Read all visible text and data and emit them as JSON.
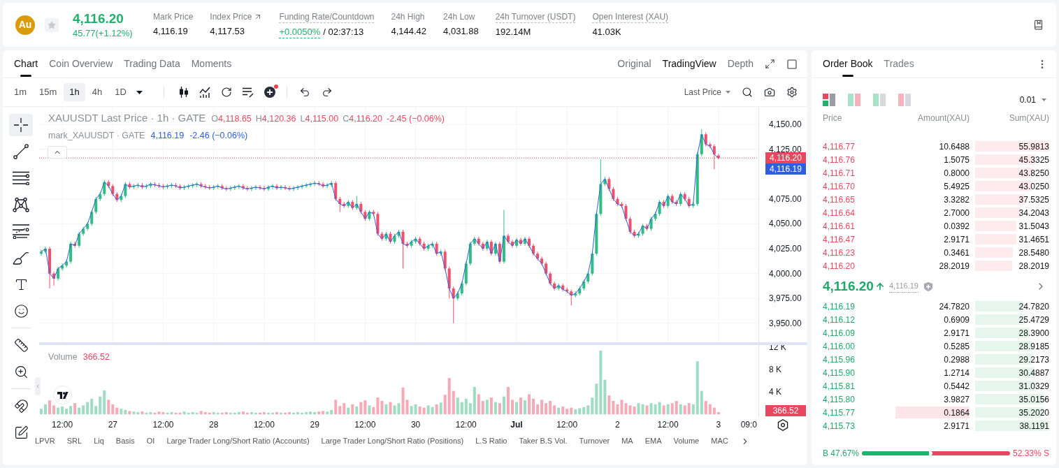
{
  "header": {
    "logo": "Au",
    "price": "4,116.20",
    "change": "45.77(+1.12%)",
    "stats": [
      {
        "label": "Mark Price",
        "value": "4,116.19",
        "kind": "plain",
        "underlined": false
      },
      {
        "label": "Index Price",
        "value": "4,117.53",
        "kind": "link",
        "underlined": false
      },
      {
        "label": "Funding Rate/Countdown",
        "value": "+0.0050%",
        "extra": "/ 02:37:13",
        "kind": "funding",
        "underlined": true
      },
      {
        "label": "24h High",
        "value": "4,144.42",
        "kind": "plain",
        "underlined": false
      },
      {
        "label": "24h Low",
        "value": "4,031.88",
        "kind": "plain",
        "underlined": false
      },
      {
        "label": "24h Turnover (USDT)",
        "value": "192.14M",
        "kind": "plain",
        "underlined": true
      },
      {
        "label": "Open Interest (XAU)",
        "value": "41.03K",
        "kind": "plain",
        "underlined": true
      }
    ]
  },
  "chart_panel": {
    "tabs": [
      {
        "label": "Chart",
        "selected": true
      },
      {
        "label": "Coin Overview",
        "selected": false
      },
      {
        "label": "Trading Data",
        "selected": false
      },
      {
        "label": "Moments",
        "selected": false
      }
    ],
    "view_modes": [
      {
        "label": "Original",
        "selected": false
      },
      {
        "label": "TradingView",
        "selected": true
      },
      {
        "label": "Depth",
        "selected": false
      }
    ],
    "intervals": [
      {
        "label": "1m",
        "selected": false
      },
      {
        "label": "15m",
        "selected": false
      },
      {
        "label": "1h",
        "selected": true
      },
      {
        "label": "4h",
        "selected": false
      },
      {
        "label": "1D",
        "selected": false
      }
    ],
    "tools": [
      {
        "kind": "candles",
        "badge": false
      },
      {
        "kind": "indicators",
        "badge": false
      },
      {
        "kind": "replay",
        "badge": false
      },
      {
        "kind": "templates",
        "badge": false
      },
      {
        "kind": "add",
        "badge": true
      }
    ],
    "price_source": "Last Price",
    "drawing_tool_groups": [
      {
        "tools": [
          {
            "kind": "crosshair",
            "selected": true
          },
          {
            "kind": "trend_line",
            "selected": false
          },
          {
            "kind": "horizontal_lines",
            "selected": false
          },
          {
            "kind": "pattern",
            "selected": false
          },
          {
            "kind": "fib",
            "selected": false
          },
          {
            "kind": "brush",
            "selected": false
          },
          {
            "kind": "text",
            "selected": false
          },
          {
            "kind": "emoji",
            "selected": false
          }
        ]
      },
      {
        "tools": [
          {
            "kind": "ruler",
            "selected": false
          },
          {
            "kind": "zoom",
            "selected": false
          }
        ]
      },
      {
        "tools": [
          {
            "kind": "magnet",
            "selected": false
          },
          {
            "kind": "pencil",
            "selected": false
          }
        ]
      }
    ],
    "legend": {
      "title": "XAUUSDT Last Price · 1h · GATE",
      "ohlc": [
        {
          "label": "O",
          "value": "4,118.65"
        },
        {
          "label": "H",
          "value": "4,120.36"
        },
        {
          "label": "L",
          "value": "4,115.00"
        },
        {
          "label": "C",
          "value": "4,116.20"
        }
      ],
      "change": "-2.45 (−0.06%)",
      "mark_title": "mark_XAUUSDT · GATE",
      "mark_value": "4,116.19",
      "mark_change": "-2.46 (−0.06%)"
    },
    "mark_tag": "4,116.19",
    "chart_data": {
      "type": "candlestick",
      "grid": true,
      "ylim": [
        3930.9,
        4167.6
      ],
      "yticks": [
        {
          "value": 3950,
          "label": "3,950.00"
        },
        {
          "value": 3975,
          "label": "3,975.00"
        },
        {
          "value": 4000,
          "label": "4,000.00"
        },
        {
          "value": 4025,
          "label": "4,025.00"
        },
        {
          "value": 4050,
          "label": "4,050.00"
        },
        {
          "value": 4075,
          "label": "4,075.00"
        },
        {
          "value": 4125,
          "label": "4,125.00"
        },
        {
          "value": 4150,
          "label": "4,150.00"
        }
      ],
      "ref_lines": [
        {
          "axis": "y",
          "value": 4116.2,
          "color": "#e8485f",
          "label": "4,116.20"
        }
      ],
      "categories": [
        null,
        null,
        null,
        null,
        null,
        null,
        null,
        null,
        null,
        null,
        null,
        null,
        null,
        null,
        null,
        null,
        null,
        null,
        null,
        null,
        null,
        null,
        null,
        null,
        null,
        null,
        null,
        null,
        null,
        null,
        null,
        null,
        null,
        null,
        null,
        null,
        null,
        null,
        null,
        null,
        null,
        null,
        null,
        null,
        null,
        null,
        null,
        null,
        null,
        null,
        null,
        null,
        null,
        null,
        null,
        null,
        null,
        null,
        null,
        null,
        null,
        null,
        null,
        null,
        null,
        null,
        null,
        null,
        null,
        null,
        null,
        null,
        null,
        null,
        null,
        null,
        null,
        null,
        null,
        null,
        null,
        null,
        null,
        null,
        null,
        null,
        null,
        null,
        null,
        null,
        null,
        null,
        null,
        null,
        null,
        null,
        null,
        null,
        null,
        null,
        null,
        null,
        null,
        null,
        null,
        null,
        null,
        null,
        null,
        null,
        null,
        null,
        null,
        null,
        null,
        null,
        null,
        null,
        null,
        null,
        null,
        null,
        null,
        null,
        null,
        null,
        null,
        null,
        null,
        null,
        null,
        null,
        null,
        null,
        null,
        null,
        null,
        null,
        null,
        null,
        null,
        null,
        null,
        null,
        null,
        null,
        null,
        null,
        null,
        null,
        null,
        null,
        null,
        null,
        null,
        null,
        null,
        null,
        null,
        null,
        null,
        null,
        null,
        null,
        null,
        null,
        null,
        null,
        null,
        null,
        null
      ],
      "ohlc": [
        [
          4020,
          4024,
          4018,
          4022
        ],
        [
          4022,
          4027,
          4020,
          4025
        ],
        [
          4025,
          4027,
          3985,
          4000
        ],
        [
          4000,
          4002,
          3988,
          3995
        ],
        [
          3995,
          4007,
          3993,
          4005
        ],
        [
          4005,
          4010,
          4003,
          4008
        ],
        [
          4008,
          4014,
          4006,
          4012
        ],
        [
          4012,
          4032,
          4010,
          4030
        ],
        [
          4030,
          4032,
          4026,
          4028
        ],
        [
          4028,
          4042,
          4026,
          4040
        ],
        [
          4040,
          4047,
          4038,
          4045
        ],
        [
          4045,
          4052,
          4043,
          4050
        ],
        [
          4050,
          4064,
          4048,
          4062
        ],
        [
          4062,
          4077,
          4060,
          4075
        ],
        [
          4075,
          4082,
          4073,
          4080
        ],
        [
          4080,
          4094,
          4078,
          4092
        ],
        [
          4092,
          4094,
          4086,
          4088
        ],
        [
          4088,
          4090,
          4078,
          4080
        ],
        [
          4080,
          4082,
          4072,
          4074
        ],
        [
          4074,
          4080,
          4072,
          4078
        ],
        [
          4078,
          4092,
          4076,
          4090
        ],
        [
          4090,
          4092,
          4085,
          4087
        ],
        [
          4087,
          4090,
          4085,
          4088
        ],
        [
          4088,
          4091,
          4086,
          4089
        ],
        [
          4089,
          4091,
          4085,
          4087
        ],
        [
          4087,
          4090,
          4085,
          4088
        ],
        [
          4088,
          4092,
          4086,
          4090
        ],
        [
          4090,
          4092,
          4087,
          4089
        ],
        [
          4089,
          4091,
          4086,
          4088
        ],
        [
          4088,
          4090,
          4085,
          4087
        ],
        [
          4087,
          4090,
          4085,
          4088
        ],
        [
          4088,
          4091,
          4086,
          4089
        ],
        [
          4089,
          4091,
          4086,
          4088
        ],
        [
          4088,
          4090,
          4084,
          4086
        ],
        [
          4086,
          4089,
          4084,
          4087
        ],
        [
          4087,
          4090,
          4085,
          4088
        ],
        [
          4088,
          4091,
          4086,
          4089
        ],
        [
          4089,
          4092,
          4087,
          4090
        ],
        [
          4090,
          4092,
          4086,
          4088
        ],
        [
          4088,
          4090,
          4085,
          4087
        ],
        [
          4087,
          4089,
          4084,
          4086
        ],
        [
          4086,
          4089,
          4084,
          4087
        ],
        [
          4087,
          4090,
          4085,
          4088
        ],
        [
          4088,
          4090,
          4084,
          4086
        ],
        [
          4086,
          4088,
          4083,
          4085
        ],
        [
          4085,
          4088,
          4083,
          4086
        ],
        [
          4086,
          4089,
          4084,
          4087
        ],
        [
          4087,
          4090,
          4085,
          4088
        ],
        [
          4088,
          4090,
          4084,
          4086
        ],
        [
          4086,
          4088,
          4083,
          4085
        ],
        [
          4085,
          4088,
          4083,
          4086
        ],
        [
          4086,
          4089,
          4084,
          4087
        ],
        [
          4087,
          4089,
          4084,
          4086
        ],
        [
          4086,
          4088,
          4083,
          4085
        ],
        [
          4085,
          4089,
          4083,
          4087
        ],
        [
          4087,
          4090,
          4085,
          4088
        ],
        [
          4088,
          4090,
          4084,
          4086
        ],
        [
          4086,
          4089,
          4084,
          4087
        ],
        [
          4087,
          4089,
          4084,
          4086
        ],
        [
          4086,
          4088,
          4083,
          4085
        ],
        [
          4085,
          4088,
          4083,
          4086
        ],
        [
          4086,
          4089,
          4084,
          4087
        ],
        [
          4087,
          4090,
          4085,
          4088
        ],
        [
          4088,
          4091,
          4086,
          4089
        ],
        [
          4089,
          4092,
          4087,
          4090
        ],
        [
          4090,
          4093,
          4088,
          4091
        ],
        [
          4091,
          4093,
          4088,
          4090
        ],
        [
          4090,
          4092,
          4086,
          4088
        ],
        [
          4088,
          4091,
          4086,
          4089
        ],
        [
          4089,
          4093,
          4087,
          4091
        ],
        [
          4091,
          4093,
          4073,
          4075
        ],
        [
          4075,
          4077,
          4062,
          4070
        ],
        [
          4070,
          4072,
          4066,
          4068
        ],
        [
          4068,
          4074,
          4066,
          4072
        ],
        [
          4072,
          4074,
          4064,
          4066
        ],
        [
          4066,
          4078,
          4064,
          4070
        ],
        [
          4070,
          4072,
          4060,
          4062
        ],
        [
          4062,
          4064,
          4053,
          4055
        ],
        [
          4055,
          4064,
          4053,
          4062
        ],
        [
          4062,
          4064,
          4058,
          4060
        ],
        [
          4060,
          4062,
          4038,
          4040
        ],
        [
          4040,
          4042,
          4033,
          4035
        ],
        [
          4035,
          4042,
          4033,
          4040
        ],
        [
          4040,
          4042,
          4030,
          4032
        ],
        [
          4032,
          4040,
          4030,
          4038
        ],
        [
          4038,
          4044,
          4036,
          4042
        ],
        [
          4042,
          4044,
          4005,
          4030
        ],
        [
          4030,
          4032,
          4026,
          4028
        ],
        [
          4028,
          4034,
          4026,
          4032
        ],
        [
          4032,
          4037,
          4030,
          4035
        ],
        [
          4035,
          4037,
          4028,
          4030
        ],
        [
          4030,
          4032,
          4023,
          4025
        ],
        [
          4025,
          4030,
          4023,
          4028
        ],
        [
          4028,
          4032,
          4026,
          4030
        ],
        [
          4030,
          4032,
          4018,
          4020
        ],
        [
          4020,
          4024,
          4018,
          4022
        ],
        [
          4022,
          4024,
          4003,
          4005
        ],
        [
          4005,
          4007,
          3975,
          3985
        ],
        [
          3985,
          3987,
          3950,
          3975
        ],
        [
          3975,
          3982,
          3973,
          3980
        ],
        [
          3980,
          3992,
          3978,
          3990
        ],
        [
          3990,
          4012,
          3988,
          4010
        ],
        [
          4010,
          4032,
          4008,
          4030
        ],
        [
          4030,
          4037,
          4028,
          4035
        ],
        [
          4035,
          4037,
          4028,
          4030
        ],
        [
          4030,
          4032,
          4023,
          4025
        ],
        [
          4025,
          4034,
          4023,
          4032
        ],
        [
          4032,
          4034,
          4018,
          4020
        ],
        [
          4020,
          4032,
          4018,
          4030
        ],
        [
          4030,
          4032,
          4010,
          4012
        ],
        [
          4012,
          4064,
          4010,
          4038
        ],
        [
          4038,
          4040,
          4030,
          4032
        ],
        [
          4032,
          4034,
          4026,
          4028
        ],
        [
          4028,
          4036,
          4026,
          4034
        ],
        [
          4034,
          4036,
          4028,
          4030
        ],
        [
          4030,
          4037,
          4028,
          4035
        ],
        [
          4035,
          4037,
          4026,
          4028
        ],
        [
          4028,
          4030,
          4018,
          4020
        ],
        [
          4020,
          4022,
          4013,
          4015
        ],
        [
          4015,
          4017,
          4008,
          4010
        ],
        [
          4010,
          4012,
          3998,
          4000
        ],
        [
          4000,
          4002,
          3988,
          3990
        ],
        [
          3990,
          3992,
          3983,
          3985
        ],
        [
          3985,
          3990,
          3983,
          3988
        ],
        [
          3988,
          3990,
          3982,
          3984
        ],
        [
          3984,
          3986,
          3980,
          3982
        ],
        [
          3982,
          3984,
          3968,
          3978
        ],
        [
          3978,
          3982,
          3976,
          3980
        ],
        [
          3980,
          3987,
          3978,
          3985
        ],
        [
          3985,
          3994,
          3983,
          3992
        ],
        [
          3992,
          4002,
          3990,
          4000
        ],
        [
          4000,
          4022,
          3998,
          4020
        ],
        [
          4020,
          4062,
          4018,
          4060
        ],
        [
          4060,
          4115,
          4058,
          4090
        ],
        [
          4090,
          4097,
          4088,
          4095
        ],
        [
          4095,
          4097,
          4083,
          4085
        ],
        [
          4085,
          4087,
          4073,
          4075
        ],
        [
          4075,
          4077,
          4068,
          4070
        ],
        [
          4070,
          4072,
          4066,
          4068
        ],
        [
          4068,
          4070,
          4053,
          4055
        ],
        [
          4055,
          4057,
          4040,
          4042
        ],
        [
          4042,
          4044,
          4036,
          4038
        ],
        [
          4038,
          4042,
          4036,
          4040
        ],
        [
          4040,
          4050,
          4038,
          4048
        ],
        [
          4048,
          4050,
          4043,
          4045
        ],
        [
          4045,
          4057,
          4043,
          4055
        ],
        [
          4055,
          4062,
          4053,
          4060
        ],
        [
          4060,
          4074,
          4058,
          4072
        ],
        [
          4072,
          4074,
          4066,
          4068
        ],
        [
          4068,
          4080,
          4066,
          4078
        ],
        [
          4078,
          4080,
          4070,
          4072
        ],
        [
          4072,
          4074,
          4068,
          4070
        ],
        [
          4070,
          4082,
          4068,
          4080
        ],
        [
          4080,
          4082,
          4073,
          4075
        ],
        [
          4075,
          4077,
          4066,
          4068
        ],
        [
          4068,
          4072,
          4066,
          4070
        ],
        [
          4070,
          4122,
          4068,
          4120
        ],
        [
          4120,
          4145,
          4118,
          4140
        ],
        [
          4140,
          4142,
          4128,
          4130
        ],
        [
          4130,
          4132,
          4126,
          4128
        ],
        [
          4128,
          4130,
          4105,
          4120
        ],
        [
          4118.65,
          4120.36,
          4115,
          4116.2
        ],
        null,
        null,
        null,
        null,
        null,
        null,
        null,
        null,
        null
      ],
      "series": [
        {
          "type": "line",
          "color": "#2f5fe0",
          "values": [
            4022,
            4025,
            4000,
            3995,
            4005,
            4008,
            4012,
            4030,
            4028,
            4040,
            4045,
            4050,
            4062,
            4075,
            4080,
            4092,
            4088,
            4080,
            4074,
            4078,
            4090,
            4087,
            4088,
            4089,
            4087,
            4088,
            4090,
            4089,
            4088,
            4087,
            4088,
            4089,
            4088,
            4086,
            4087,
            4088,
            4089,
            4090,
            4088,
            4087,
            4086,
            4087,
            4088,
            4086,
            4085,
            4086,
            4087,
            4088,
            4086,
            4085,
            4086,
            4087,
            4086,
            4085,
            4087,
            4088,
            4086,
            4087,
            4086,
            4085,
            4086,
            4087,
            4088,
            4089,
            4090,
            4091,
            4090,
            4088,
            4089,
            4091,
            4075,
            4070,
            4068,
            4072,
            4066,
            4070,
            4062,
            4055,
            4062,
            4060,
            4040,
            4035,
            4040,
            4032,
            4038,
            4042,
            4030,
            4028,
            4032,
            4035,
            4030,
            4025,
            4028,
            4030,
            4020,
            4022,
            4005,
            3985,
            3975,
            3980,
            3990,
            4010,
            4030,
            4035,
            4030,
            4025,
            4032,
            4020,
            4030,
            4012,
            4038,
            4032,
            4028,
            4034,
            4030,
            4035,
            4028,
            4020,
            4015,
            4010,
            4000,
            3990,
            3985,
            3988,
            3984,
            3982,
            3978,
            3980,
            3985,
            3992,
            4000,
            4020,
            4060,
            4090,
            4095,
            4085,
            4075,
            4070,
            4068,
            4055,
            4042,
            4038,
            4040,
            4048,
            4045,
            4055,
            4060,
            4072,
            4068,
            4078,
            4072,
            4070,
            4080,
            4075,
            4068,
            4070,
            4120,
            4140,
            4130,
            4128,
            4120,
            4116,
            null,
            null,
            null,
            null,
            null,
            null,
            null,
            null,
            null
          ]
        }
      ]
    },
    "volume": {
      "title": "Volume",
      "value": "366.52",
      "tag": "366.52",
      "chart_data": {
        "type": "bar",
        "ylim": [
          -0.6,
          12.4
        ],
        "yticks": [
          {
            "value": 4,
            "label": "4 K"
          },
          {
            "value": 8,
            "label": "8 K"
          },
          {
            "value": 12,
            "label": "12 K"
          }
        ],
        "categories": [
          null,
          null,
          null,
          null,
          null,
          null,
          null,
          null,
          null,
          null,
          null,
          null,
          null,
          null,
          null,
          null,
          null,
          null,
          null,
          null,
          null,
          null,
          null,
          null,
          null,
          null,
          null,
          null,
          null,
          null,
          null,
          null,
          null,
          null,
          null,
          null,
          null,
          null,
          null,
          null,
          null,
          null,
          null,
          null,
          null,
          null,
          null,
          null,
          null,
          null,
          null,
          null,
          null,
          null,
          null,
          null,
          null,
          null,
          null,
          null,
          null,
          null,
          null,
          null,
          null,
          null,
          null,
          null,
          null,
          null,
          null,
          null,
          null,
          null,
          null,
          null,
          null,
          null,
          null,
          null,
          null,
          null,
          null,
          null,
          null,
          null,
          null,
          null,
          null,
          null,
          null,
          null,
          null,
          null,
          null,
          null,
          null,
          null,
          null,
          null,
          null,
          null,
          null,
          null,
          null,
          null,
          null,
          null,
          null,
          null,
          null,
          null,
          null,
          null,
          null,
          null,
          null,
          null,
          null,
          null,
          null,
          null,
          null,
          null,
          null,
          null,
          null,
          null,
          null,
          null,
          null,
          null,
          null,
          null,
          null,
          null,
          null,
          null,
          null,
          null,
          null,
          null,
          null,
          null,
          null,
          null,
          null,
          null,
          null,
          null,
          null,
          null,
          null,
          null,
          null,
          null,
          null,
          null,
          null,
          null,
          null,
          null,
          null,
          null,
          null,
          null,
          null,
          null,
          null,
          null,
          null
        ],
        "series": [
          {
            "color": "#9edcc3",
            "values": [
              1.0,
              1.8,
              null,
              null,
              1.2,
              1.4,
              1.0,
              1.5,
              null,
              1.2,
              1.6,
              2.2,
              2.8,
              1.5,
              3.2,
              4.3,
              null,
              null,
              null,
              1.0,
              0.8,
              null,
              0.5,
              0.4,
              null,
              0.3,
              0.4,
              null,
              null,
              null,
              0.3,
              0.4,
              null,
              null,
              0.5,
              0.3,
              0.4,
              0.3,
              null,
              null,
              null,
              0.4,
              0.3,
              null,
              null,
              0.3,
              0.3,
              0.4,
              null,
              null,
              0.4,
              0.3,
              null,
              null,
              0.3,
              0.3,
              null,
              0.3,
              null,
              null,
              0.3,
              0.4,
              0.3,
              0.4,
              0.5,
              0.4,
              null,
              null,
              0.5,
              0.8,
              null,
              null,
              null,
              1.2,
              null,
              1.4,
              null,
              null,
              1.6,
              null,
              null,
              null,
              1.8,
              null,
              1.6,
              2.0,
              null,
              null,
              1.5,
              1.8,
              null,
              null,
              1.6,
              1.3,
              null,
              2.1,
              null,
              null,
              null,
              3.0,
              2.2,
              2.8,
              2.0,
              4.9,
              null,
              null,
              2.6,
              null,
              2.2,
              null,
              3.2,
              null,
              null,
              2.2,
              null,
              2.5,
              null,
              null,
              null,
              null,
              null,
              null,
              null,
              1.2,
              null,
              null,
              null,
              0.9,
              1.1,
              1.3,
              1.6,
              3.0,
              5.5,
              11.4,
              6.2,
              null,
              null,
              null,
              null,
              null,
              null,
              null,
              2.0,
              1.8,
              null,
              2.0,
              1.8,
              2.2,
              null,
              1.8,
              null,
              null,
              1.8,
              null,
              null,
              1.8,
              9.5,
              4.2,
              null,
              null,
              null,
              null,
              null,
              null,
              null,
              null,
              null,
              null,
              null,
              null,
              null
            ]
          },
          {
            "color": "#f6a9b6",
            "values": [
              null,
              null,
              2.5,
              1.6,
              null,
              null,
              null,
              null,
              2.0,
              null,
              null,
              null,
              null,
              null,
              null,
              null,
              2.6,
              1.8,
              1.2,
              null,
              null,
              0.6,
              null,
              null,
              0.5,
              null,
              null,
              0.3,
              0.5,
              0.4,
              null,
              null,
              0.3,
              0.3,
              null,
              null,
              null,
              null,
              0.6,
              0.4,
              0.3,
              null,
              null,
              0.3,
              0.4,
              null,
              null,
              null,
              0.5,
              0.3,
              null,
              null,
              0.3,
              0.4,
              null,
              null,
              0.4,
              null,
              0.3,
              0.4,
              null,
              null,
              null,
              null,
              null,
              null,
              0.5,
              0.6,
              null,
              null,
              2.6,
              1.5,
              2.0,
              null,
              1.8,
              null,
              2.2,
              2.5,
              null,
              1.3,
              3.0,
              2.4,
              null,
              2.2,
              null,
              null,
              4.8,
              2.6,
              null,
              null,
              1.4,
              1.2,
              null,
              null,
              1.8,
              null,
              3.5,
              6.5,
              4.2,
              null,
              null,
              null,
              null,
              null,
              3.6,
              2.4,
              null,
              3.0,
              null,
              2.0,
              null,
              4.9,
              2.6,
              null,
              3.0,
              null,
              3.6,
              2.8,
              1.8,
              2.6,
              2.0,
              2.4,
              1.6,
              null,
              1.4,
              1.0,
              1.2,
              null,
              null,
              null,
              null,
              null,
              null,
              null,
              null,
              3.4,
              2.4,
              1.8,
              2.6,
              2.0,
              1.6,
              1.4,
              null,
              null,
              1.6,
              null,
              null,
              null,
              1.6,
              null,
              2.0,
              2.4,
              null,
              1.6,
              2.0,
              null,
              null,
              null,
              2.4,
              1.8,
              1.2,
              0.4,
              null,
              null,
              null,
              null,
              null,
              null,
              null,
              null,
              null
            ]
          }
        ]
      }
    },
    "time_axis": [
      {
        "label": "12:00",
        "kind": "time"
      },
      {
        "label": "27",
        "kind": "day"
      },
      {
        "label": "12:00",
        "kind": "time"
      },
      {
        "label": "28",
        "kind": "day"
      },
      {
        "label": "12:00",
        "kind": "time"
      },
      {
        "label": "29",
        "kind": "day"
      },
      {
        "label": "12:00",
        "kind": "time"
      },
      {
        "label": "30",
        "kind": "day"
      },
      {
        "label": "12:00",
        "kind": "time"
      },
      {
        "label": "Jul",
        "kind": "month"
      },
      {
        "label": "12:00",
        "kind": "time"
      },
      {
        "label": "2",
        "kind": "day"
      },
      {
        "label": "12:00",
        "kind": "time"
      },
      {
        "label": "3",
        "kind": "day"
      },
      {
        "label": "09:0",
        "kind": "time"
      }
    ],
    "indicators": [
      "LPVR",
      "SRL",
      "Liq",
      "Basis",
      "OI",
      "Large Trader Long/Short Ratio (Accounts)",
      "Large Trader Long/Short Ratio (Positions)",
      "L.S Ratio",
      "Taker B.S Vol.",
      "Turnover",
      "MA",
      "EMA",
      "Volume",
      "MAC"
    ]
  },
  "order_book": {
    "tabs": [
      {
        "label": "Order Book",
        "selected": true
      },
      {
        "label": "Trades",
        "selected": false
      }
    ],
    "layouts": [
      {
        "kind": "both",
        "selected": true
      },
      {
        "kind": "side_by_side",
        "selected": false
      },
      {
        "kind": "bids",
        "selected": false
      },
      {
        "kind": "asks",
        "selected": false
      }
    ],
    "precision": "0.01",
    "columns": [
      "Price",
      "Amount(XAU)",
      "Sum(XAU)"
    ],
    "asks": [
      {
        "price": "4,116.77",
        "amount": "10.6488",
        "sum": "55.9813",
        "level": 1.0,
        "highlighted": false
      },
      {
        "price": "4,116.76",
        "amount": "1.5075",
        "sum": "45.3325",
        "level": 0.81,
        "highlighted": false
      },
      {
        "price": "4,116.71",
        "amount": "0.8000",
        "sum": "43.8250",
        "level": 0.78,
        "highlighted": false
      },
      {
        "price": "4,116.70",
        "amount": "5.4925",
        "sum": "43.0250",
        "level": 0.77,
        "highlighted": false
      },
      {
        "price": "4,116.65",
        "amount": "3.3282",
        "sum": "37.5325",
        "level": 0.67,
        "highlighted": false
      },
      {
        "price": "4,116.64",
        "amount": "2.7000",
        "sum": "34.2043",
        "level": 0.61,
        "highlighted": false
      },
      {
        "price": "4,116.61",
        "amount": "0.0392",
        "sum": "31.5043",
        "level": 0.56,
        "highlighted": false
      },
      {
        "price": "4,116.47",
        "amount": "2.9171",
        "sum": "31.4651",
        "level": 0.56,
        "highlighted": false
      },
      {
        "price": "4,116.23",
        "amount": "0.3461",
        "sum": "28.5480",
        "level": 0.51,
        "highlighted": false
      },
      {
        "price": "4,116.20",
        "amount": "28.2019",
        "sum": "28.2019",
        "level": 0.5,
        "highlighted": false
      }
    ],
    "last_price": "4,116.20",
    "mark_price": "4,116.19",
    "bids": [
      {
        "price": "4,116.19",
        "amount": "24.7820",
        "sum": "24.7820",
        "level": 0.65,
        "highlighted": false
      },
      {
        "price": "4,116.12",
        "amount": "0.6909",
        "sum": "25.4729",
        "level": 0.67,
        "highlighted": false
      },
      {
        "price": "4,116.09",
        "amount": "2.9171",
        "sum": "28.3900",
        "level": 0.74,
        "highlighted": false
      },
      {
        "price": "4,116.00",
        "amount": "0.5285",
        "sum": "28.9185",
        "level": 0.76,
        "highlighted": false
      },
      {
        "price": "4,115.96",
        "amount": "0.2988",
        "sum": "29.2173",
        "level": 0.77,
        "highlighted": false
      },
      {
        "price": "4,115.90",
        "amount": "1.2714",
        "sum": "30.4887",
        "level": 0.8,
        "highlighted": false
      },
      {
        "price": "4,115.81",
        "amount": "0.5442",
        "sum": "31.0329",
        "level": 0.81,
        "highlighted": false
      },
      {
        "price": "4,115.80",
        "amount": "3.9827",
        "sum": "35.0156",
        "level": 0.92,
        "highlighted": false
      },
      {
        "price": "4,115.77",
        "amount": "0.1864",
        "sum": "35.2020",
        "level": 0.92,
        "highlighted": true
      },
      {
        "price": "4,115.73",
        "amount": "2.9171",
        "sum": "38.1191",
        "level": 1.0,
        "highlighted": false
      }
    ],
    "ratio": {
      "buy": "B 47.67%",
      "sell": "52.33% S",
      "level": 0.4767
    }
  }
}
